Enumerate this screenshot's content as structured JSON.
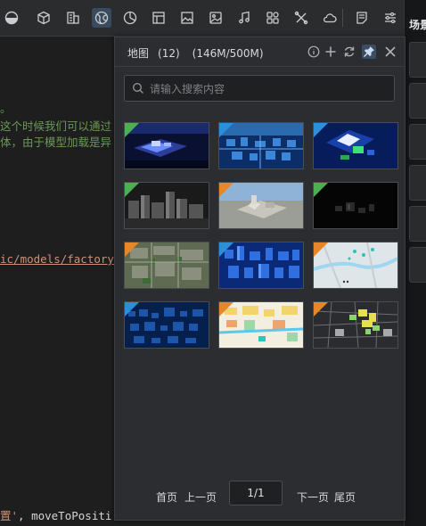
{
  "toolbar": {
    "icons": [
      "pie-toggle-icon",
      "cube-icon",
      "building-icon",
      "globe-icon",
      "clock-chart-icon",
      "layout-icon",
      "image-icon",
      "photo-icon",
      "music-icon",
      "component-icon",
      "tools-icon",
      "cloud-icon",
      "note-icon",
      "settings-sliders-icon"
    ],
    "active": "globe-icon"
  },
  "right_panel": {
    "title": "场景"
  },
  "editor": {
    "line1": "。",
    "line2": "这个时候我们可以通过",
    "line3": "体，由于模型加载是异",
    "line4": "ic/models/factory",
    "line5_a": "置'",
    "line5_b": ", moveToPositi"
  },
  "map_panel": {
    "title": "地图",
    "count": "(12)",
    "storage": "(146M/500M)",
    "search_placeholder": "请输入搜索内容",
    "thumbnails": [
      {
        "name": "map-thumb-1",
        "badge": "green"
      },
      {
        "name": "map-thumb-2",
        "badge": "blue"
      },
      {
        "name": "map-thumb-3",
        "badge": "blue"
      },
      {
        "name": "map-thumb-4",
        "badge": "green"
      },
      {
        "name": "map-thumb-5",
        "badge": "orange"
      },
      {
        "name": "map-thumb-6",
        "badge": "green"
      },
      {
        "name": "map-thumb-7",
        "badge": "orange"
      },
      {
        "name": "map-thumb-8",
        "badge": "blue"
      },
      {
        "name": "map-thumb-9",
        "badge": "orange"
      },
      {
        "name": "map-thumb-10",
        "badge": "blue"
      },
      {
        "name": "map-thumb-11",
        "badge": "orange"
      },
      {
        "name": "map-thumb-12",
        "badge": "orange"
      }
    ],
    "pagination": {
      "first": "首页",
      "prev": "上一页",
      "current": "1/1",
      "next": "下一页",
      "last": "尾页"
    }
  },
  "colors": {
    "accent": "#3b4b5e",
    "panel_bg": "#2b2d30",
    "badge_green": "#4caf50",
    "badge_blue": "#2d8fd5",
    "badge_orange": "#e8862a"
  }
}
